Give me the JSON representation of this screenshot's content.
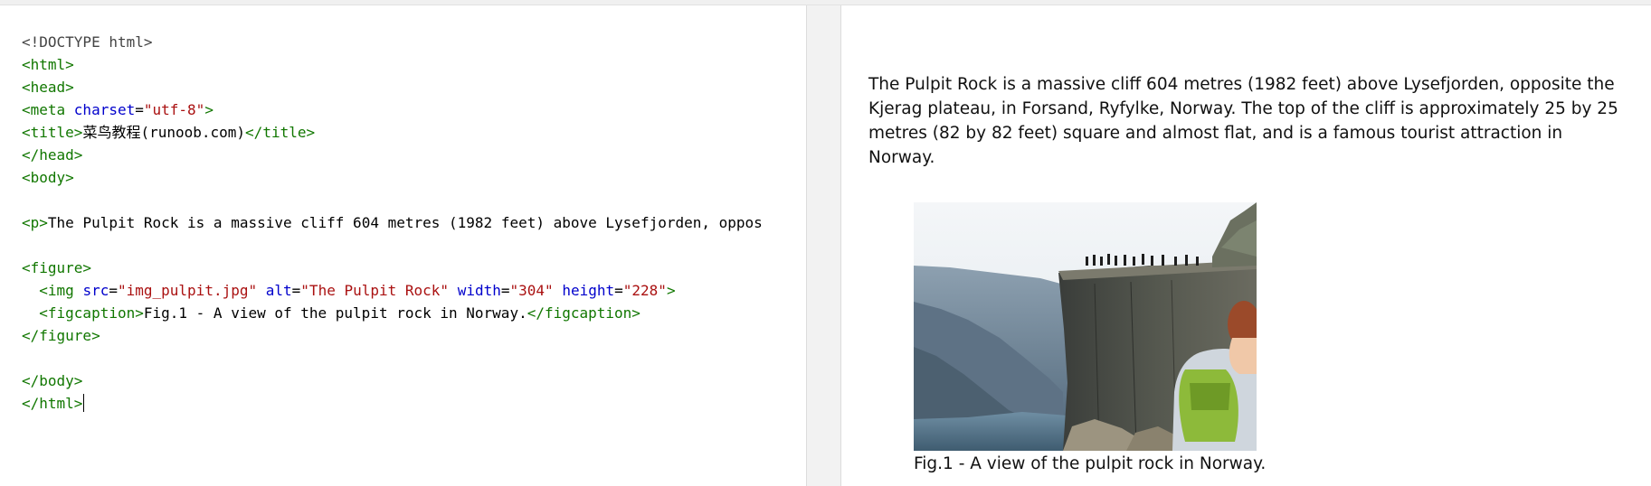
{
  "editor": {
    "lines": [
      [
        {
          "t": "doctype",
          "v": "<!DOCTYPE html>"
        }
      ],
      [
        {
          "t": "tag",
          "v": "<html>"
        }
      ],
      [
        {
          "t": "tag",
          "v": "<head>"
        }
      ],
      [
        {
          "t": "tag",
          "v": "<meta "
        },
        {
          "t": "attr",
          "v": "charset"
        },
        {
          "t": "text",
          "v": "="
        },
        {
          "t": "str",
          "v": "\"utf-8\""
        },
        {
          "t": "tag",
          "v": ">"
        }
      ],
      [
        {
          "t": "tag",
          "v": "<title>"
        },
        {
          "t": "text",
          "v": "菜鸟教程(runoob.com)"
        },
        {
          "t": "tag",
          "v": "</title>"
        }
      ],
      [
        {
          "t": "tag",
          "v": "</head>"
        }
      ],
      [
        {
          "t": "tag",
          "v": "<body>"
        }
      ],
      [],
      [
        {
          "t": "tag",
          "v": "<p>"
        },
        {
          "t": "text",
          "v": "The Pulpit Rock is a massive cliff 604 metres (1982 feet) above Lysefjorden, oppos"
        }
      ],
      [],
      [
        {
          "t": "tag",
          "v": "<figure>"
        }
      ],
      [
        {
          "t": "text",
          "v": "  "
        },
        {
          "t": "tag",
          "v": "<img "
        },
        {
          "t": "attr",
          "v": "src"
        },
        {
          "t": "text",
          "v": "="
        },
        {
          "t": "str",
          "v": "\"img_pulpit.jpg\""
        },
        {
          "t": "text",
          "v": " "
        },
        {
          "t": "attr",
          "v": "alt"
        },
        {
          "t": "text",
          "v": "="
        },
        {
          "t": "str",
          "v": "\"The Pulpit Rock\""
        },
        {
          "t": "text",
          "v": " "
        },
        {
          "t": "attr",
          "v": "width"
        },
        {
          "t": "text",
          "v": "="
        },
        {
          "t": "str",
          "v": "\"304\""
        },
        {
          "t": "text",
          "v": " "
        },
        {
          "t": "attr",
          "v": "height"
        },
        {
          "t": "text",
          "v": "="
        },
        {
          "t": "str",
          "v": "\"228\""
        },
        {
          "t": "tag",
          "v": ">"
        }
      ],
      [
        {
          "t": "text",
          "v": "  "
        },
        {
          "t": "tag",
          "v": "<figcaption>"
        },
        {
          "t": "text",
          "v": "Fig.1 - A view of the pulpit rock in Norway."
        },
        {
          "t": "tag",
          "v": "</figcaption>"
        }
      ],
      [
        {
          "t": "tag",
          "v": "</figure>"
        }
      ],
      [],
      [
        {
          "t": "tag",
          "v": "</body>"
        }
      ],
      [
        {
          "t": "tag",
          "v": "</html>"
        }
      ]
    ]
  },
  "result": {
    "paragraph": "The Pulpit Rock is a massive cliff 604 metres (1982 feet) above Lysefjorden, opposite the Kjerag plateau, in Forsand, Ryfylke, Norway. The top of the cliff is approximately 25 by 25 metres (82 by 82 feet) square and almost flat, and is a famous tourist attraction in Norway.",
    "image_alt": "The Pulpit Rock",
    "caption": "Fig.1 - A view of the pulpit rock in Norway."
  }
}
